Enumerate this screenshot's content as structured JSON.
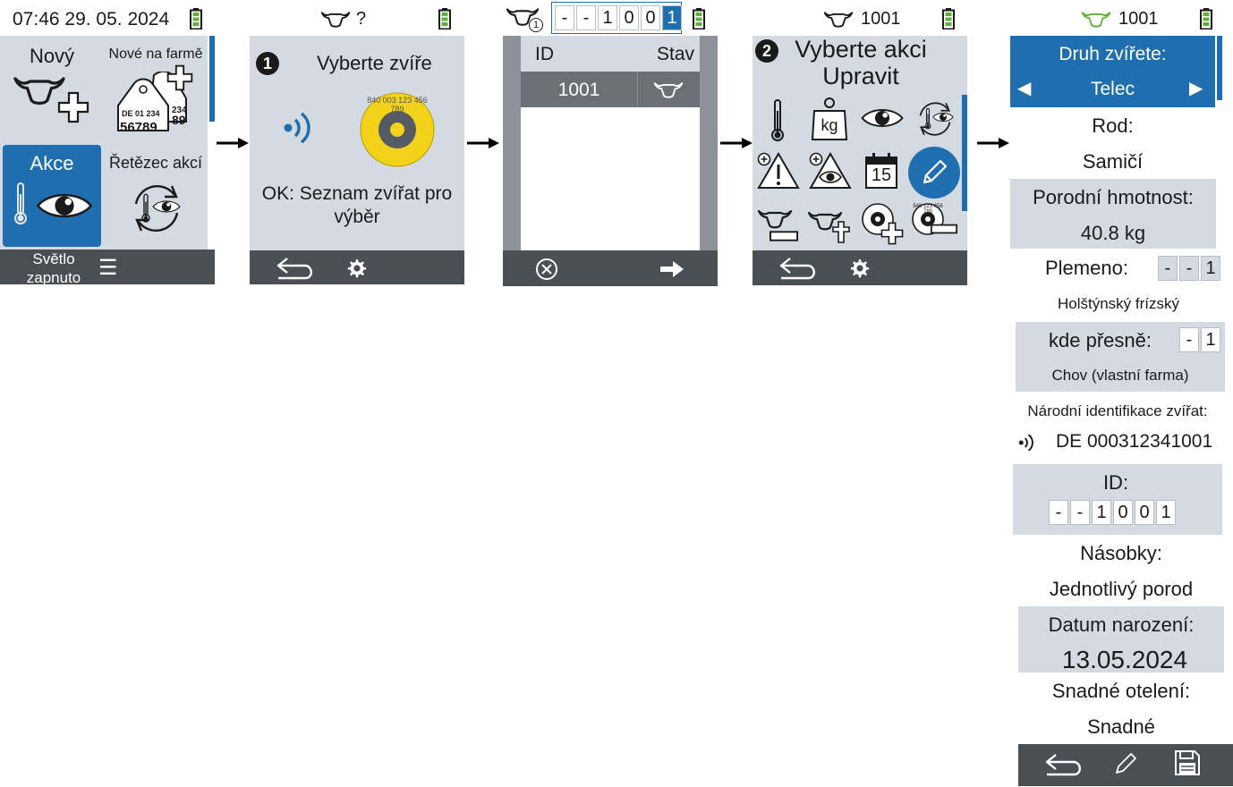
{
  "screen1": {
    "status_time": "07:46 29. 05. 2024",
    "tile_new": "Nový",
    "tile_new_farm": "Nové na farmě",
    "tag_line1": "DE 01 234",
    "tag_line2": "56789",
    "tag_back": "234",
    "tag_back2": "89",
    "tile_actions": "Akce",
    "tile_chain": "Řetězec akcí",
    "footer_light_1": "Světlo",
    "footer_light_2": "zapnuto"
  },
  "screen2": {
    "status_id": "?",
    "step": "1",
    "heading": "Vyberte zvíře",
    "tag_number": "840 003 123 456 789",
    "message": "OK: Seznam zvířat pro výběr"
  },
  "screen3": {
    "status_badge": "1",
    "id_digits": [
      "-",
      "-",
      "1",
      "0",
      "0",
      "1"
    ],
    "col_id": "ID",
    "col_state": "Stav",
    "row_id": "1001"
  },
  "screen4": {
    "status_id": "1001",
    "step": "2",
    "heading_1": "Vyberte akci",
    "heading_2": "Upravit",
    "kg_label": "kg",
    "calendar_day": "15",
    "disc_text": "840 123 456 789"
  },
  "screen5": {
    "status_id": "1001",
    "species_label": "Druh zvířete:",
    "species_value": "Telec",
    "sex_label": "Rod:",
    "sex_value": "Samičí",
    "birth_weight_label": "Porodní hmotnost:",
    "birth_weight_value": "40.8 kg",
    "breed_label": "Plemeno:",
    "breed_digits": [
      "-",
      "-",
      "1"
    ],
    "breed_value": "Holštýnský frízský",
    "where_label": "kde přesně:",
    "where_digits": [
      "-",
      "1"
    ],
    "where_value": "Chov (vlastní farma)",
    "national_id_label": "Národní identifikace zvířat:",
    "national_id_value": "DE 000312341001",
    "id_label": "ID:",
    "id_digits": [
      "-",
      "-",
      "1",
      "0",
      "0",
      "1"
    ],
    "multiples_label": "Násobky:",
    "multiples_value": "Jednotlivý porod",
    "birth_date_label": "Datum narození:",
    "birth_date_value": "13.05.2024",
    "easy_calving_label": "Snadné otelení:",
    "easy_calving_value": "Snadné"
  },
  "colors": {
    "accent": "#1f6fb0",
    "screen": "#d3dae2",
    "footer": "#4a4f55",
    "battery": "#5fb03a",
    "tag_yellow": "#f3d21a"
  }
}
